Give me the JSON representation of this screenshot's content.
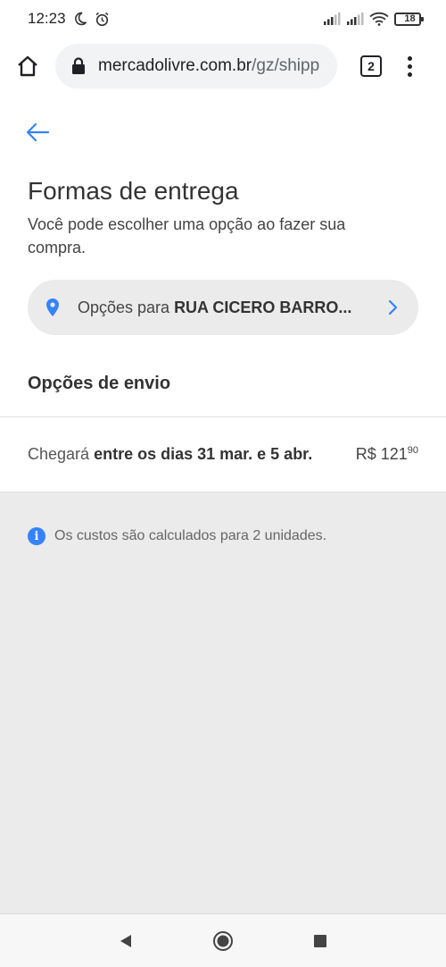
{
  "status_bar": {
    "time": "12:23",
    "icons": [
      "moon-icon",
      "alarm-icon",
      "signal-icon",
      "signal-icon",
      "wifi-icon"
    ],
    "battery_level": "18",
    "battery_color": "#e53935"
  },
  "browser": {
    "url_domain": "mercadolivre.com.br",
    "url_path": "/gz/shipp",
    "tab_count": "2"
  },
  "page": {
    "title": "Formas de entrega",
    "subtitle": "Você pode escolher uma opção ao fazer sua compra.",
    "address_prefix": "Opções para ",
    "address_name": "RUA CICERO BARRO...",
    "section_title": "Opções de envio"
  },
  "shipping_option": {
    "label_prefix": "Chegará ",
    "label_dates": "entre os dias 31 mar. e 5 abr.",
    "price_currency": "R$ 121",
    "price_cents": "90"
  },
  "info": {
    "icon": "i",
    "text": "Os custos são calculados para 2 unidades."
  },
  "colors": {
    "accent": "#3483fa",
    "background": "#ebebeb"
  }
}
